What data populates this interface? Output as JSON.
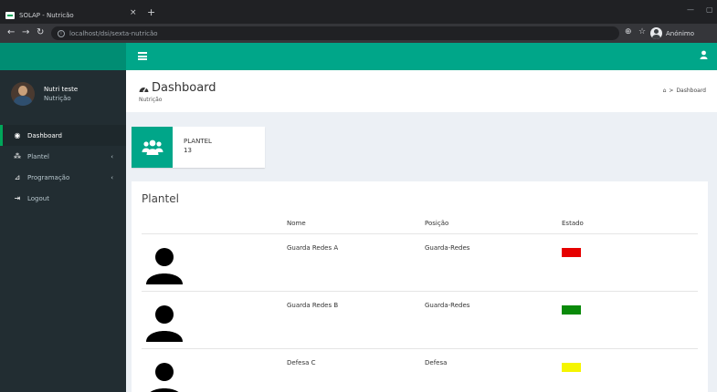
{
  "browser": {
    "tab_title": "SOLAP - Nutricão",
    "tab_close": "×",
    "new_tab": "+",
    "url": "localhost/dsi/sexta-nutricão",
    "profile_name": "Anónimo"
  },
  "sidebar": {
    "user": {
      "name": "Nutri teste",
      "role": "Nutrição"
    },
    "items": [
      {
        "label": "Dashboard",
        "icon": "dashboard-icon",
        "active": true
      },
      {
        "label": "Plantel",
        "icon": "sitemap-icon",
        "caret": "‹"
      },
      {
        "label": "Programação",
        "icon": "chart-icon",
        "caret": "‹"
      },
      {
        "label": "Logout",
        "icon": "logout-icon"
      }
    ]
  },
  "header": {
    "title": "Dashboard",
    "subtitle": "Nutrição",
    "breadcrumb": "Dashboard"
  },
  "info_box": {
    "label": "PLANTEL",
    "value": "13",
    "color": "#00a689"
  },
  "roster": {
    "title": "Plantel",
    "columns": [
      "Nome",
      "Posição",
      "Estado"
    ],
    "rows": [
      {
        "name": "Guarda Redes A",
        "position": "Guarda-Redes",
        "status_color": "#e60000"
      },
      {
        "name": "Guarda Redes B",
        "position": "Guarda-Redes",
        "status_color": "#0a8a0a"
      },
      {
        "name": "Defesa C",
        "position": "Defesa",
        "status_color": "#f5f500"
      }
    ]
  },
  "colors": {
    "brand": "#00a689",
    "sidebar": "#222d32"
  }
}
